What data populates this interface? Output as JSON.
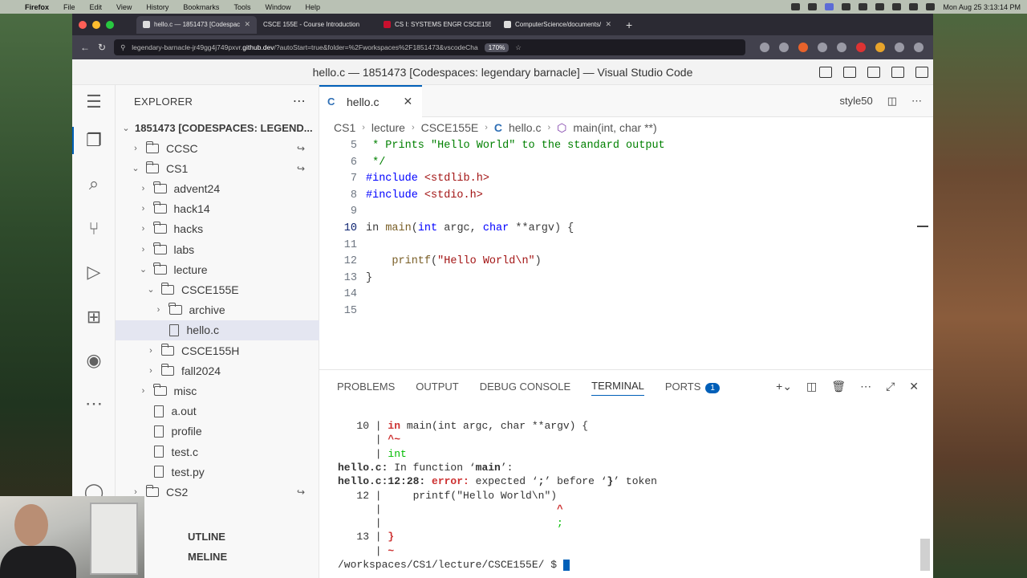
{
  "menubar": {
    "app": "Firefox",
    "items": [
      "File",
      "Edit",
      "View",
      "History",
      "Bookmarks",
      "Tools",
      "Window",
      "Help"
    ],
    "datetime": "Mon Aug 25  3:13:14 PM"
  },
  "browser": {
    "tabs": [
      {
        "label": "hello.c — 1851473 [Codespaces",
        "active": true
      },
      {
        "label": "CSCE 155E - Course Introduction",
        "active": false
      },
      {
        "label": "CS I: SYSTEMS ENGR CSCE155E",
        "active": false
      },
      {
        "label": "ComputerScience/documents/s",
        "active": false
      }
    ],
    "url_pre": "legendary-barnacle-jr49gg4j749pxvr.",
    "url_host": "github.dev",
    "url_post": "/?autoStart=true&folder=%2Fworkspaces%2F1851473&vscodeCha",
    "zoom": "170%"
  },
  "vscode": {
    "title": "hello.c — 1851473 [Codespaces: legendary barnacle] — Visual Studio Code",
    "explorer_label": "EXPLORER",
    "root": "1851473 [CODESPACES: LEGEND...",
    "tree": [
      {
        "label": "CCSC",
        "depth": 0,
        "type": "folder",
        "open": false,
        "sync": true
      },
      {
        "label": "CS1",
        "depth": 0,
        "type": "folder",
        "open": true,
        "sync": true
      },
      {
        "label": "advent24",
        "depth": 1,
        "type": "folder",
        "open": false
      },
      {
        "label": "hack14",
        "depth": 1,
        "type": "folder",
        "open": false
      },
      {
        "label": "hacks",
        "depth": 1,
        "type": "folder",
        "open": false
      },
      {
        "label": "labs",
        "depth": 1,
        "type": "folder",
        "open": false
      },
      {
        "label": "lecture",
        "depth": 1,
        "type": "folder",
        "open": true
      },
      {
        "label": "CSCE155E",
        "depth": 2,
        "type": "folder",
        "open": true
      },
      {
        "label": "archive",
        "depth": 3,
        "type": "folder",
        "open": false
      },
      {
        "label": "hello.c",
        "depth": 3,
        "type": "file",
        "selected": true
      },
      {
        "label": "CSCE155H",
        "depth": 2,
        "type": "folder",
        "open": false
      },
      {
        "label": "fall2024",
        "depth": 2,
        "type": "folder",
        "open": false
      },
      {
        "label": "misc",
        "depth": 1,
        "type": "folder",
        "open": false
      },
      {
        "label": "a.out",
        "depth": 1,
        "type": "file"
      },
      {
        "label": "profile",
        "depth": 1,
        "type": "file"
      },
      {
        "label": "test.c",
        "depth": 1,
        "type": "file"
      },
      {
        "label": "test.py",
        "depth": 1,
        "type": "file"
      },
      {
        "label": "CS2",
        "depth": 0,
        "type": "folder",
        "open": false,
        "sync": true
      }
    ],
    "outline": "UTLINE",
    "timeline": "MELINE",
    "editor_tab": "hello.c",
    "editor_right": "style50",
    "breadcrumbs": [
      "CS1",
      "lecture",
      "CSCE155E",
      "hello.c",
      "main(int, char **)"
    ],
    "code": [
      {
        "n": "5",
        "html": "<span class='cm'> * Prints \"Hello World\" to the standard output</span>"
      },
      {
        "n": "6",
        "html": "<span class='cm'> */</span>"
      },
      {
        "n": "7",
        "html": "<span class='mc'>#include</span> <span class='st'>&lt;stdlib.h&gt;</span>"
      },
      {
        "n": "8",
        "html": "<span class='mc'>#include</span> <span class='st'>&lt;stdio.h&gt;</span>"
      },
      {
        "n": "9",
        "html": ""
      },
      {
        "n": "10",
        "html": "in <span class='fn'>main</span>(<span class='ty'>int</span> argc, <span class='ty'>char</span> **argv) {",
        "cur": true
      },
      {
        "n": "11",
        "html": ""
      },
      {
        "n": "12",
        "html": "    <span class='fn'>printf</span>(<span class='st'>\"Hello World\\n\"</span>)"
      },
      {
        "n": "13",
        "html": "}"
      },
      {
        "n": "14",
        "html": ""
      },
      {
        "n": "15",
        "html": ""
      }
    ],
    "panel_tabs": [
      "PROBLEMS",
      "OUTPUT",
      "DEBUG CONSOLE",
      "TERMINAL",
      "PORTS"
    ],
    "ports_badge": "1",
    "terminal": [
      "   10 | <span class='tred'>in</span> main(int argc, char **argv) {",
      "      | <span class='tred'>^~</span>",
      "      | <span class='tgreen'>int</span>",
      "<span class='tb'>hello.c:</span> In function ‘<span class='tb'>main</span>’:",
      "<span class='tb'>hello.c:12:28:</span> <span class='tred'>error:</span> expected ‘<span class='tb'>;</span>’ before ‘<span class='tb'>}</span>’ token",
      "   12 |     printf(\"Hello World\\n\")",
      "      |                            <span class='tred'>^</span>",
      "      |                            <span class='tgreen'>;</span>",
      "   13 | <span class='tred'>}</span>",
      "      | <span class='tred'>~</span>"
    ],
    "prompt": "/workspaces/CS1/lecture/CSCE155E/ $ "
  }
}
